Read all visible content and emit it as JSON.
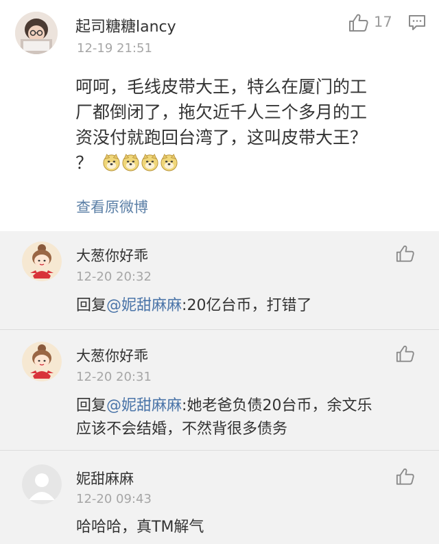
{
  "main_comment": {
    "username": "起司糖糖lancy",
    "timestamp": "12-19 21:51",
    "like_count": "17",
    "text_lines": [
      "呵呵，毛线皮带大王，特么在厦门的工",
      "厂都倒闭了，拖欠近千人三个多月的工",
      "资没付就跑回台湾了，这叫皮带大王？"
    ],
    "text_line_4": "？",
    "emoji_name": "doge-emoji",
    "view_original_label": "查看原微博"
  },
  "replies": [
    {
      "username": "大葱你好乖",
      "timestamp": "12-20 20:32",
      "reply_prefix": "回复",
      "mention": "@妮甜麻麻",
      "text": ":20亿台币，打错了"
    },
    {
      "username": "大葱你好乖",
      "timestamp": "12-20 20:31",
      "reply_prefix": "回复",
      "mention": "@妮甜麻麻",
      "text": ":她老爸负债20台币，余文乐",
      "text_line2": "应该不会结婚，不然背很多债务"
    },
    {
      "username": "妮甜麻麻",
      "timestamp": "12-20 09:43",
      "text": "哈哈哈，真TM解气"
    }
  ],
  "colors": {
    "mention": "#4a74a8",
    "timestamp": "#a6a6a6",
    "reply_bg": "#f2f2f2",
    "main_bg": "#ffffff"
  }
}
